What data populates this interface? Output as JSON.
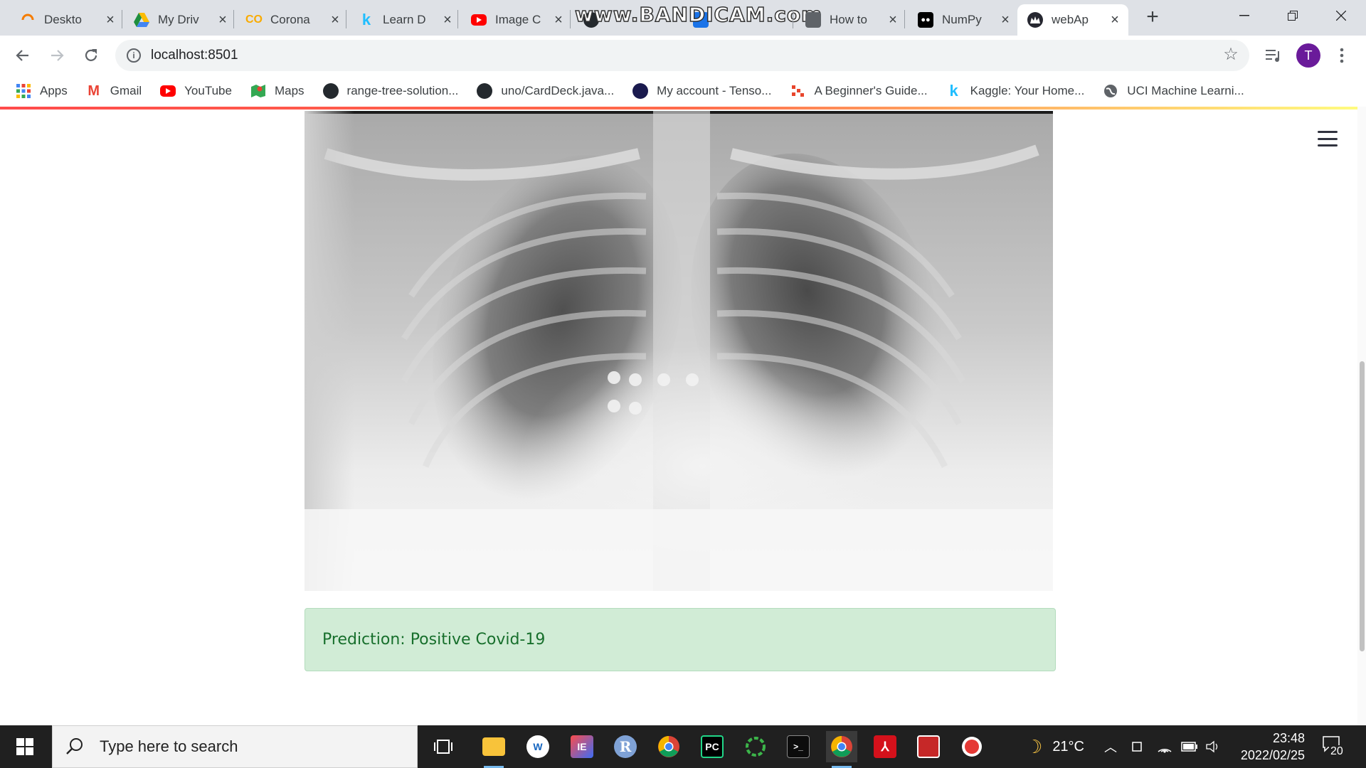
{
  "browser": {
    "tabs": [
      {
        "title": "Deskto",
        "icon": "loading-spinner-icon",
        "color": "#f57c00"
      },
      {
        "title": "My Driv",
        "icon": "google-drive-icon",
        "color": "#1e8e3e"
      },
      {
        "title": "Corona",
        "icon": "colab-icon",
        "color": "#f9ab00"
      },
      {
        "title": "Learn D",
        "icon": "kaggle-icon",
        "color": "#20beff"
      },
      {
        "title": "Image C",
        "icon": "youtube-icon",
        "color": "#ff0000"
      },
      {
        "title": "",
        "icon": "github-icon",
        "color": "#24292e"
      },
      {
        "title": "",
        "icon": "grid-icon",
        "color": "#1a73e8"
      },
      {
        "title": "How to",
        "icon": "document-icon",
        "color": "#5f6368"
      },
      {
        "title": "NumPy",
        "icon": "medium-icon",
        "color": "#000000"
      },
      {
        "title": "webAp",
        "icon": "streamlit-crown-icon",
        "color": "#262730"
      }
    ],
    "watermark": "www.BANDICAM.com",
    "url": "localhost:8501",
    "profile_initial": "T",
    "bookmarks": [
      {
        "label": "Apps",
        "icon": "apps-grid-icon",
        "color": "#4285f4"
      },
      {
        "label": "Gmail",
        "icon": "gmail-icon",
        "color": "#ea4335"
      },
      {
        "label": "YouTube",
        "icon": "youtube-icon",
        "color": "#ff0000"
      },
      {
        "label": "Maps",
        "icon": "maps-icon",
        "color": "#34a853"
      },
      {
        "label": "range-tree-solution...",
        "icon": "github-icon",
        "color": "#24292e"
      },
      {
        "label": "uno/CardDeck.java...",
        "icon": "github-icon",
        "color": "#24292e"
      },
      {
        "label": "My account - Tenso...",
        "icon": "tensor-account-icon",
        "color": "#1a1a4e"
      },
      {
        "label": "A Beginner's Guide...",
        "icon": "pixel-logo-icon",
        "color": "#e8452c"
      },
      {
        "label": "Kaggle: Your Home...",
        "icon": "kaggle-icon",
        "color": "#20beff"
      },
      {
        "label": "UCI Machine Learni...",
        "icon": "globe-icon",
        "color": "#5f6368"
      }
    ]
  },
  "page": {
    "prediction_text": "Prediction: Positive Covid-19",
    "accent_color": "#ff4b4b",
    "alert_bg": "#d1ecd6",
    "alert_text_color": "#176f2c"
  },
  "taskbar": {
    "search_placeholder": "Type here to search",
    "temperature": "21°C",
    "time": "23:48",
    "date": "2022/02/25",
    "notification_count": "20",
    "apps": [
      {
        "name": "task-view-icon"
      },
      {
        "name": "file-explorer-icon"
      },
      {
        "name": "word-blue-icon"
      },
      {
        "name": "intellij-icon"
      },
      {
        "name": "r-language-icon"
      },
      {
        "name": "chrome-icon"
      },
      {
        "name": "pycharm-icon"
      },
      {
        "name": "spinner-app-icon"
      },
      {
        "name": "terminal-icon"
      },
      {
        "name": "chrome-active-icon"
      },
      {
        "name": "acrobat-icon"
      },
      {
        "name": "matlab-like-icon"
      },
      {
        "name": "record-icon"
      }
    ]
  }
}
